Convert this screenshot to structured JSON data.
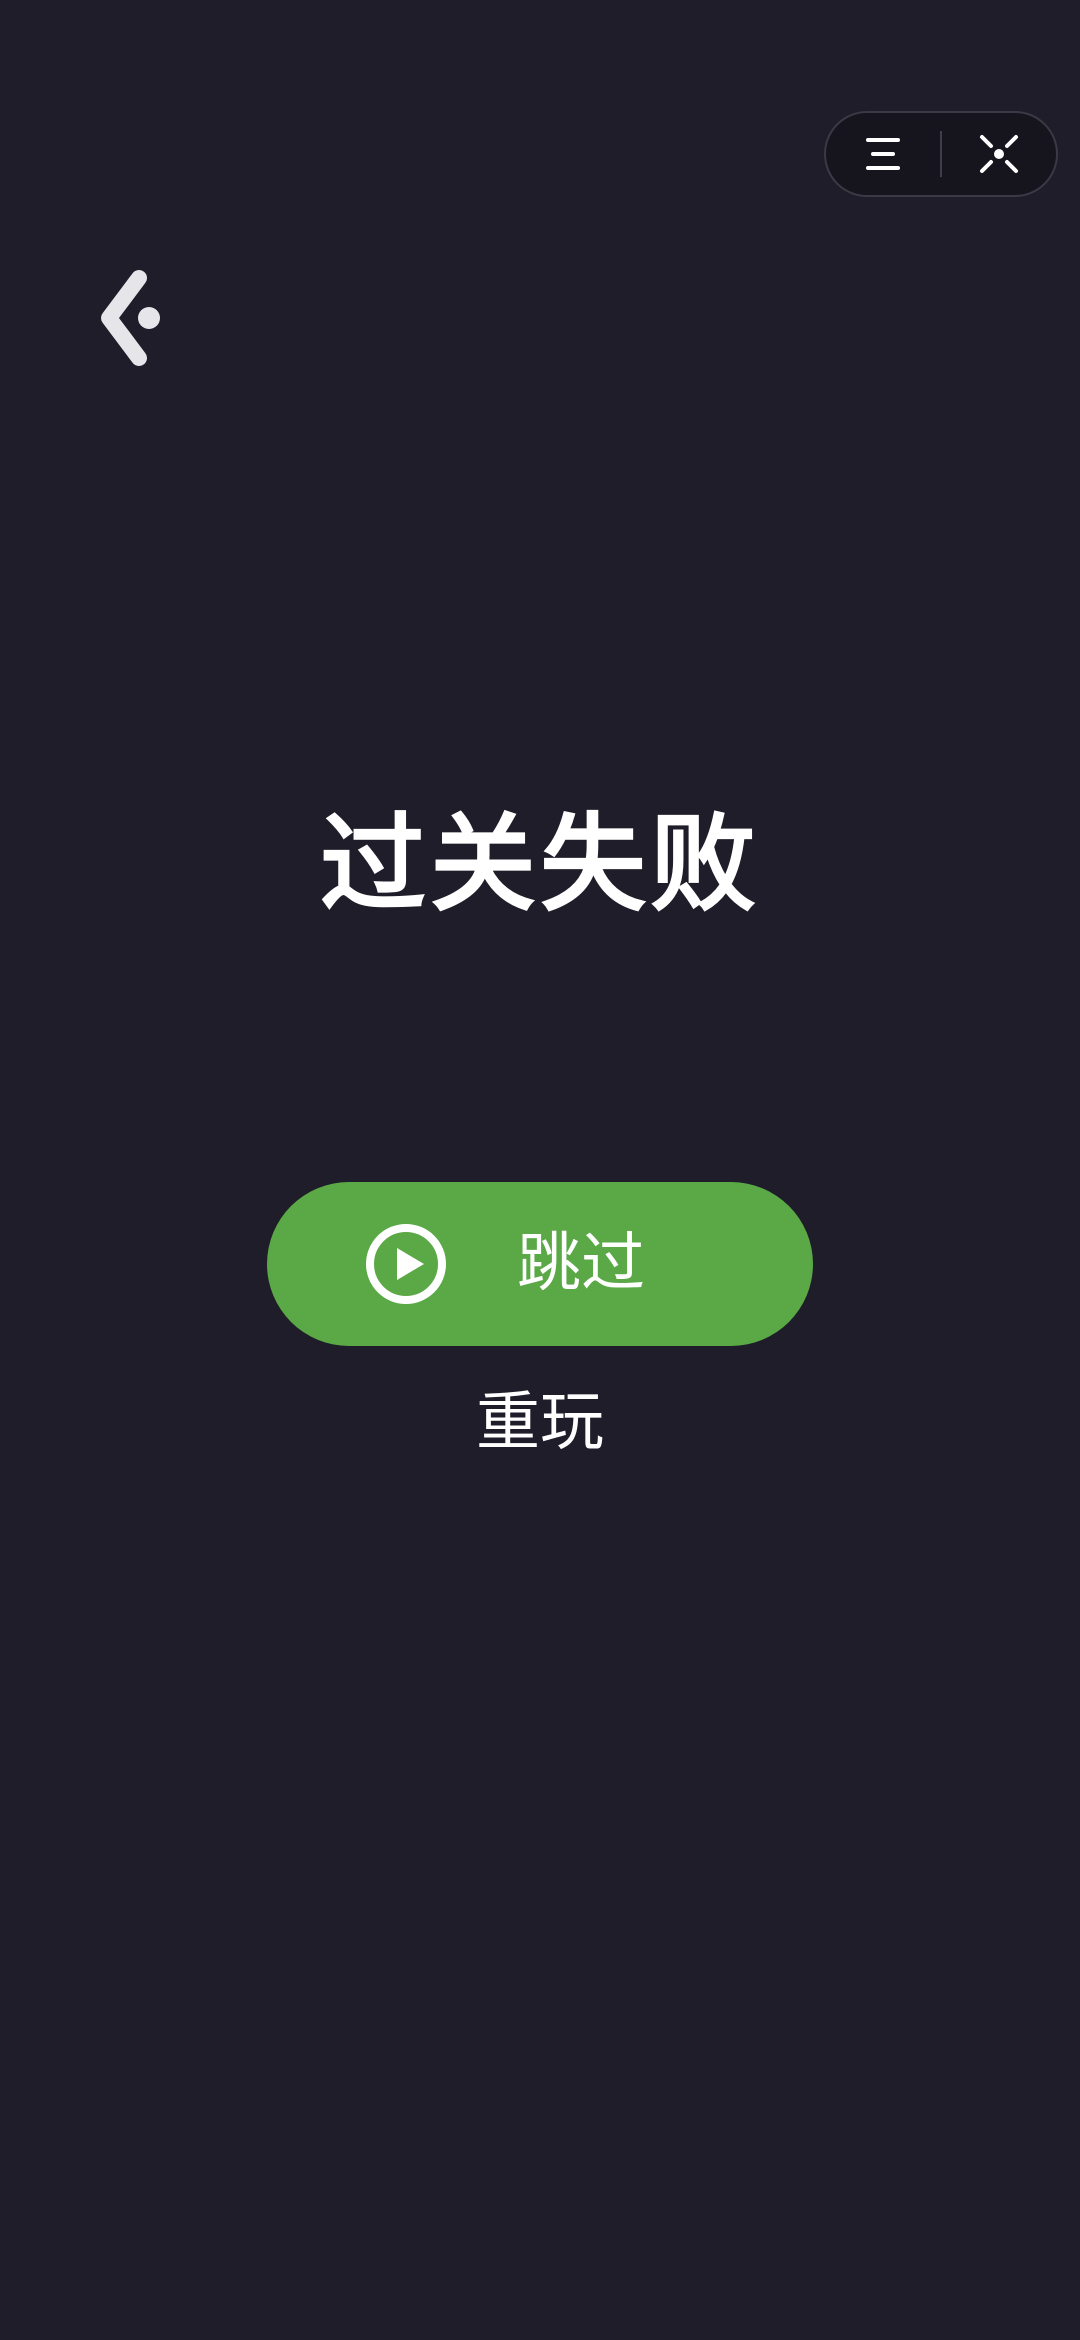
{
  "capsule": {
    "menu_icon": "menu-icon",
    "close_icon": "close-target-icon"
  },
  "back": {
    "icon": "chevron-left-dot-icon"
  },
  "result": {
    "title": "过关失败"
  },
  "actions": {
    "skip_label": "跳过",
    "skip_icon": "play-circle-icon",
    "replay_label": "重玩"
  },
  "colors": {
    "background": "#1e1d29",
    "skip_button": "#5aa946",
    "text": "#ffffff"
  }
}
